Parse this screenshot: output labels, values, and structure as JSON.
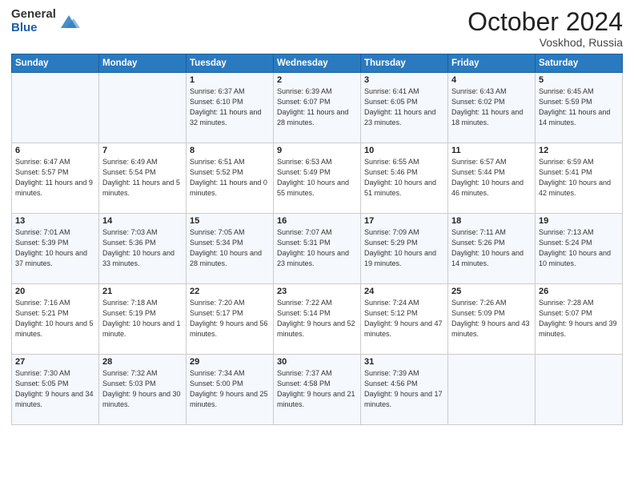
{
  "header": {
    "logo_line1": "General",
    "logo_line2": "Blue",
    "month_title": "October 2024",
    "location": "Voskhod, Russia"
  },
  "weekdays": [
    "Sunday",
    "Monday",
    "Tuesday",
    "Wednesday",
    "Thursday",
    "Friday",
    "Saturday"
  ],
  "weeks": [
    [
      {
        "day": "",
        "info": ""
      },
      {
        "day": "",
        "info": ""
      },
      {
        "day": "1",
        "info": "Sunrise: 6:37 AM\nSunset: 6:10 PM\nDaylight: 11 hours and 32 minutes."
      },
      {
        "day": "2",
        "info": "Sunrise: 6:39 AM\nSunset: 6:07 PM\nDaylight: 11 hours and 28 minutes."
      },
      {
        "day": "3",
        "info": "Sunrise: 6:41 AM\nSunset: 6:05 PM\nDaylight: 11 hours and 23 minutes."
      },
      {
        "day": "4",
        "info": "Sunrise: 6:43 AM\nSunset: 6:02 PM\nDaylight: 11 hours and 18 minutes."
      },
      {
        "day": "5",
        "info": "Sunrise: 6:45 AM\nSunset: 5:59 PM\nDaylight: 11 hours and 14 minutes."
      }
    ],
    [
      {
        "day": "6",
        "info": "Sunrise: 6:47 AM\nSunset: 5:57 PM\nDaylight: 11 hours and 9 minutes."
      },
      {
        "day": "7",
        "info": "Sunrise: 6:49 AM\nSunset: 5:54 PM\nDaylight: 11 hours and 5 minutes."
      },
      {
        "day": "8",
        "info": "Sunrise: 6:51 AM\nSunset: 5:52 PM\nDaylight: 11 hours and 0 minutes."
      },
      {
        "day": "9",
        "info": "Sunrise: 6:53 AM\nSunset: 5:49 PM\nDaylight: 10 hours and 55 minutes."
      },
      {
        "day": "10",
        "info": "Sunrise: 6:55 AM\nSunset: 5:46 PM\nDaylight: 10 hours and 51 minutes."
      },
      {
        "day": "11",
        "info": "Sunrise: 6:57 AM\nSunset: 5:44 PM\nDaylight: 10 hours and 46 minutes."
      },
      {
        "day": "12",
        "info": "Sunrise: 6:59 AM\nSunset: 5:41 PM\nDaylight: 10 hours and 42 minutes."
      }
    ],
    [
      {
        "day": "13",
        "info": "Sunrise: 7:01 AM\nSunset: 5:39 PM\nDaylight: 10 hours and 37 minutes."
      },
      {
        "day": "14",
        "info": "Sunrise: 7:03 AM\nSunset: 5:36 PM\nDaylight: 10 hours and 33 minutes."
      },
      {
        "day": "15",
        "info": "Sunrise: 7:05 AM\nSunset: 5:34 PM\nDaylight: 10 hours and 28 minutes."
      },
      {
        "day": "16",
        "info": "Sunrise: 7:07 AM\nSunset: 5:31 PM\nDaylight: 10 hours and 23 minutes."
      },
      {
        "day": "17",
        "info": "Sunrise: 7:09 AM\nSunset: 5:29 PM\nDaylight: 10 hours and 19 minutes."
      },
      {
        "day": "18",
        "info": "Sunrise: 7:11 AM\nSunset: 5:26 PM\nDaylight: 10 hours and 14 minutes."
      },
      {
        "day": "19",
        "info": "Sunrise: 7:13 AM\nSunset: 5:24 PM\nDaylight: 10 hours and 10 minutes."
      }
    ],
    [
      {
        "day": "20",
        "info": "Sunrise: 7:16 AM\nSunset: 5:21 PM\nDaylight: 10 hours and 5 minutes."
      },
      {
        "day": "21",
        "info": "Sunrise: 7:18 AM\nSunset: 5:19 PM\nDaylight: 10 hours and 1 minute."
      },
      {
        "day": "22",
        "info": "Sunrise: 7:20 AM\nSunset: 5:17 PM\nDaylight: 9 hours and 56 minutes."
      },
      {
        "day": "23",
        "info": "Sunrise: 7:22 AM\nSunset: 5:14 PM\nDaylight: 9 hours and 52 minutes."
      },
      {
        "day": "24",
        "info": "Sunrise: 7:24 AM\nSunset: 5:12 PM\nDaylight: 9 hours and 47 minutes."
      },
      {
        "day": "25",
        "info": "Sunrise: 7:26 AM\nSunset: 5:09 PM\nDaylight: 9 hours and 43 minutes."
      },
      {
        "day": "26",
        "info": "Sunrise: 7:28 AM\nSunset: 5:07 PM\nDaylight: 9 hours and 39 minutes."
      }
    ],
    [
      {
        "day": "27",
        "info": "Sunrise: 7:30 AM\nSunset: 5:05 PM\nDaylight: 9 hours and 34 minutes."
      },
      {
        "day": "28",
        "info": "Sunrise: 7:32 AM\nSunset: 5:03 PM\nDaylight: 9 hours and 30 minutes."
      },
      {
        "day": "29",
        "info": "Sunrise: 7:34 AM\nSunset: 5:00 PM\nDaylight: 9 hours and 25 minutes."
      },
      {
        "day": "30",
        "info": "Sunrise: 7:37 AM\nSunset: 4:58 PM\nDaylight: 9 hours and 21 minutes."
      },
      {
        "day": "31",
        "info": "Sunrise: 7:39 AM\nSunset: 4:56 PM\nDaylight: 9 hours and 17 minutes."
      },
      {
        "day": "",
        "info": ""
      },
      {
        "day": "",
        "info": ""
      }
    ]
  ]
}
